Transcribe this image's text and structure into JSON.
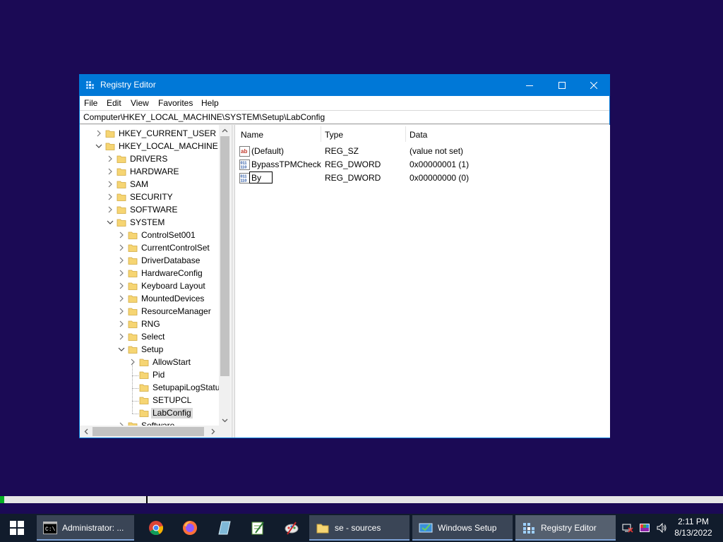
{
  "window": {
    "title": "Registry Editor",
    "menu": [
      "File",
      "Edit",
      "View",
      "Favorites",
      "Help"
    ],
    "address": "Computer\\HKEY_LOCAL_MACHINE\\SYSTEM\\Setup\\LabConfig"
  },
  "tree": [
    {
      "label": "HKEY_CURRENT_USER",
      "level": 0,
      "expanded": false
    },
    {
      "label": "HKEY_LOCAL_MACHINE",
      "level": 0,
      "expanded": true
    },
    {
      "label": "DRIVERS",
      "level": 1,
      "expanded": false
    },
    {
      "label": "HARDWARE",
      "level": 1,
      "expanded": false
    },
    {
      "label": "SAM",
      "level": 1,
      "expanded": false
    },
    {
      "label": "SECURITY",
      "level": 1,
      "expanded": false
    },
    {
      "label": "SOFTWARE",
      "level": 1,
      "expanded": false
    },
    {
      "label": "SYSTEM",
      "level": 1,
      "expanded": true
    },
    {
      "label": "ControlSet001",
      "level": 2,
      "expanded": false
    },
    {
      "label": "CurrentControlSet",
      "level": 2,
      "expanded": false
    },
    {
      "label": "DriverDatabase",
      "level": 2,
      "expanded": false
    },
    {
      "label": "HardwareConfig",
      "level": 2,
      "expanded": false
    },
    {
      "label": "Keyboard Layout",
      "level": 2,
      "expanded": false
    },
    {
      "label": "MountedDevices",
      "level": 2,
      "expanded": false
    },
    {
      "label": "ResourceManager",
      "level": 2,
      "expanded": false
    },
    {
      "label": "RNG",
      "level": 2,
      "expanded": false
    },
    {
      "label": "Select",
      "level": 2,
      "expanded": false
    },
    {
      "label": "Setup",
      "level": 2,
      "expanded": true
    },
    {
      "label": "AllowStart",
      "level": 3,
      "expanded": false
    },
    {
      "label": "Pid",
      "level": 3,
      "leaf": true
    },
    {
      "label": "SetupapiLogStatus",
      "level": 3,
      "leaf": true
    },
    {
      "label": "SETUPCL",
      "level": 3,
      "leaf": true
    },
    {
      "label": "LabConfig",
      "level": 3,
      "leaf": true,
      "selected": true
    },
    {
      "label": "Software",
      "level": 2,
      "expanded": false
    }
  ],
  "list": {
    "columns": {
      "name": "Name",
      "type": "Type",
      "data": "Data"
    },
    "rows": [
      {
        "name": "(Default)",
        "type": "REG_SZ",
        "data": "(value not set)",
        "icon": "string-value-icon"
      },
      {
        "name": "BypassTPMCheck",
        "type": "REG_DWORD",
        "data": "0x00000001 (1)",
        "icon": "dword-value-icon"
      },
      {
        "name": "",
        "type": "REG_DWORD",
        "data": "0x00000000 (0)",
        "icon": "dword-value-icon",
        "renaming": true
      }
    ],
    "rename_value": "By"
  },
  "progress": {
    "value_percent": 0.6
  },
  "taskbar": {
    "tasks": [
      {
        "label": "Administrator: ...",
        "icon": "cmd-icon"
      },
      {
        "label": "se - sources",
        "icon": "folder-icon"
      },
      {
        "label": "Windows Setup",
        "icon": "windows-setup-icon"
      },
      {
        "label": "Registry Editor",
        "icon": "regedit-icon",
        "active": true
      }
    ],
    "clock_time": "2:11 PM",
    "clock_date": "8/13/2022"
  },
  "colors": {
    "desktop": "#1b0a55",
    "titlebar": "#0078d7",
    "taskbar": "#111c2c",
    "folder": "#f6d573",
    "progress": "#06b025"
  }
}
